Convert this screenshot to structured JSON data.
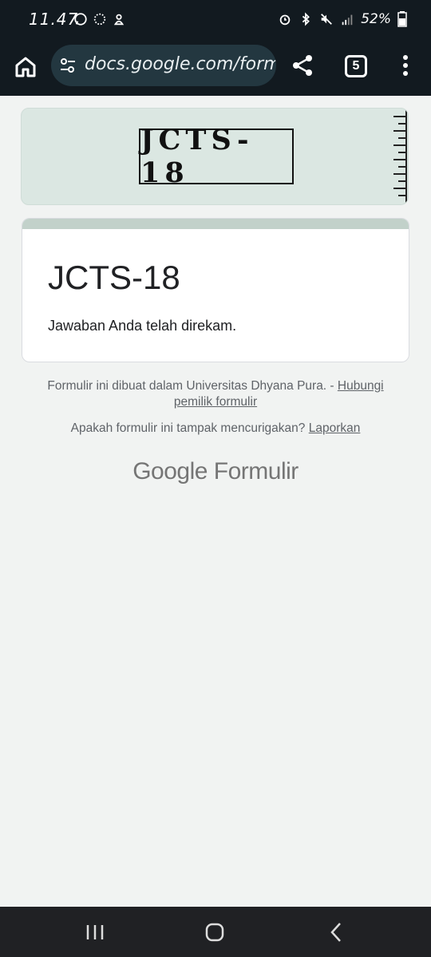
{
  "status_bar": {
    "time": "11.47",
    "left_icons": [
      "whatsapp-icon",
      "sync-icon",
      "notification-icon"
    ],
    "right_icons": [
      "alarm-icon",
      "bluetooth-icon",
      "mute-icon",
      "signal-icon"
    ],
    "battery": "52%"
  },
  "browser": {
    "url": "docs.google.com/forms",
    "home_icon": "home-icon",
    "site_settings_icon": "tune-icon",
    "share_icon": "share-icon",
    "tabs_count": "5",
    "menu_icon": "more-vert-icon"
  },
  "form": {
    "banner_logo": "JCTS-18",
    "title": "JCTS-18",
    "confirmation": "Jawaban Anda telah direkam.",
    "accent_color": "#c2d1ca",
    "banner_color": "#dbe7e2"
  },
  "footer": {
    "created_text": "Formulir ini dibuat dalam Universitas Dhyana Pura. - ",
    "contact_link": "Hubungi pemilik formulir",
    "suspicious_text": "Apakah formulir ini tampak mencurigakan? ",
    "report_link": "Laporkan",
    "brand_google": "Google",
    "brand_forms": "Formulir"
  },
  "nav": {
    "recents": "recents-icon",
    "home": "home-circle-icon",
    "back": "back-icon"
  }
}
